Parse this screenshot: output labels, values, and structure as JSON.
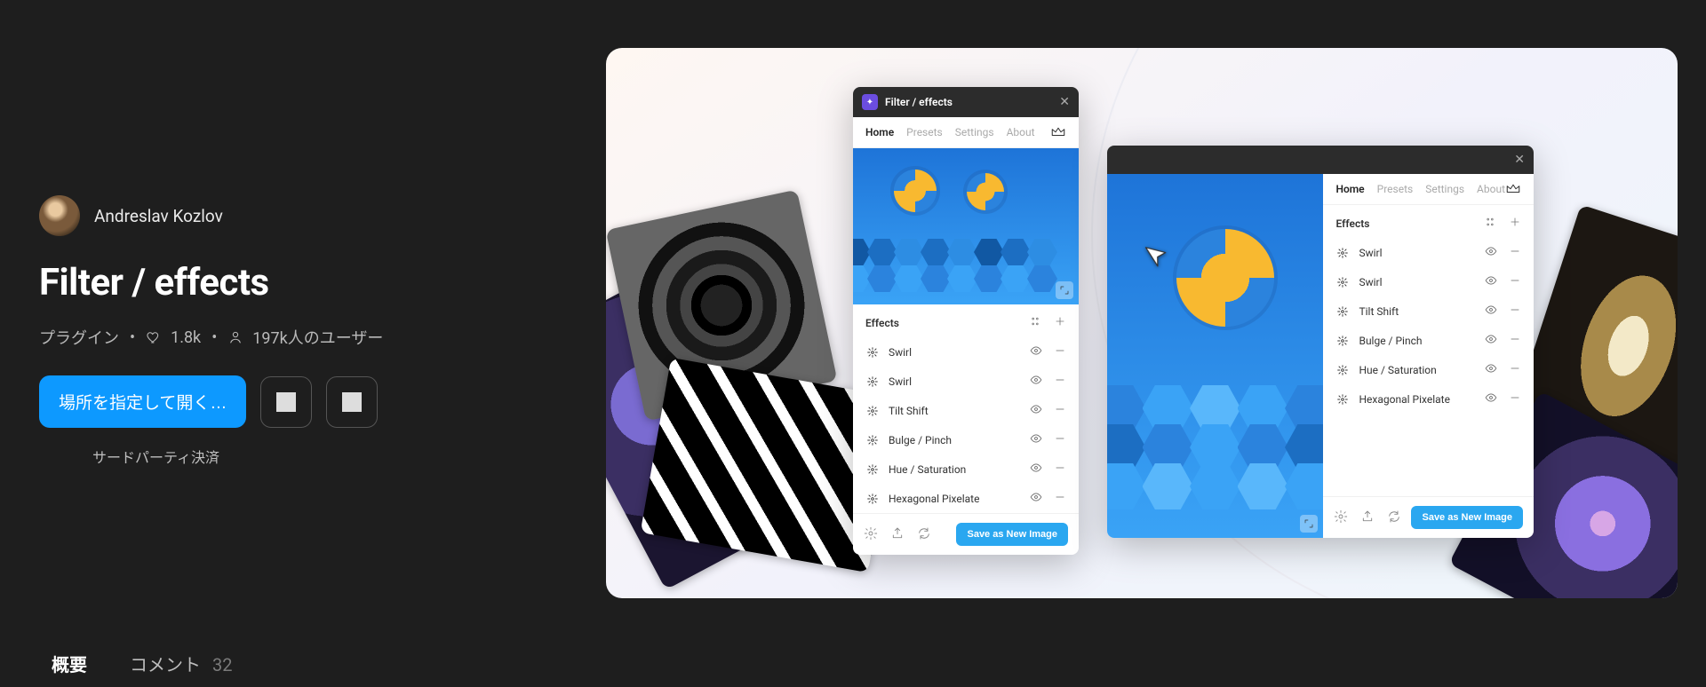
{
  "author": {
    "name": "Andreslav Kozlov"
  },
  "title": "Filter / effects",
  "meta": {
    "type": "プラグイン",
    "likes": "1.8k",
    "users": "197k人のユーザー"
  },
  "actions": {
    "open_label": "場所を指定して開く…"
  },
  "third_party": "サードパーティ決済",
  "tabs": {
    "overview": "概要",
    "comments": "コメント",
    "comments_count": "32"
  },
  "panel": {
    "title": "Filter / effects",
    "tabs": {
      "home": "Home",
      "presets": "Presets",
      "settings": "Settings",
      "about": "About"
    },
    "effects_header": "Effects",
    "save_label": "Save as New Image",
    "effects_a": [
      "Swirl",
      "Swirl",
      "Tilt Shift",
      "Bulge / Pinch",
      "Hue / Saturation",
      "Hexagonal Pixelate"
    ],
    "effects_b": [
      "Swirl",
      "Swirl",
      "Tilt Shift",
      "Bulge / Pinch",
      "Hue / Saturation",
      "Hexagonal Pixelate"
    ]
  }
}
